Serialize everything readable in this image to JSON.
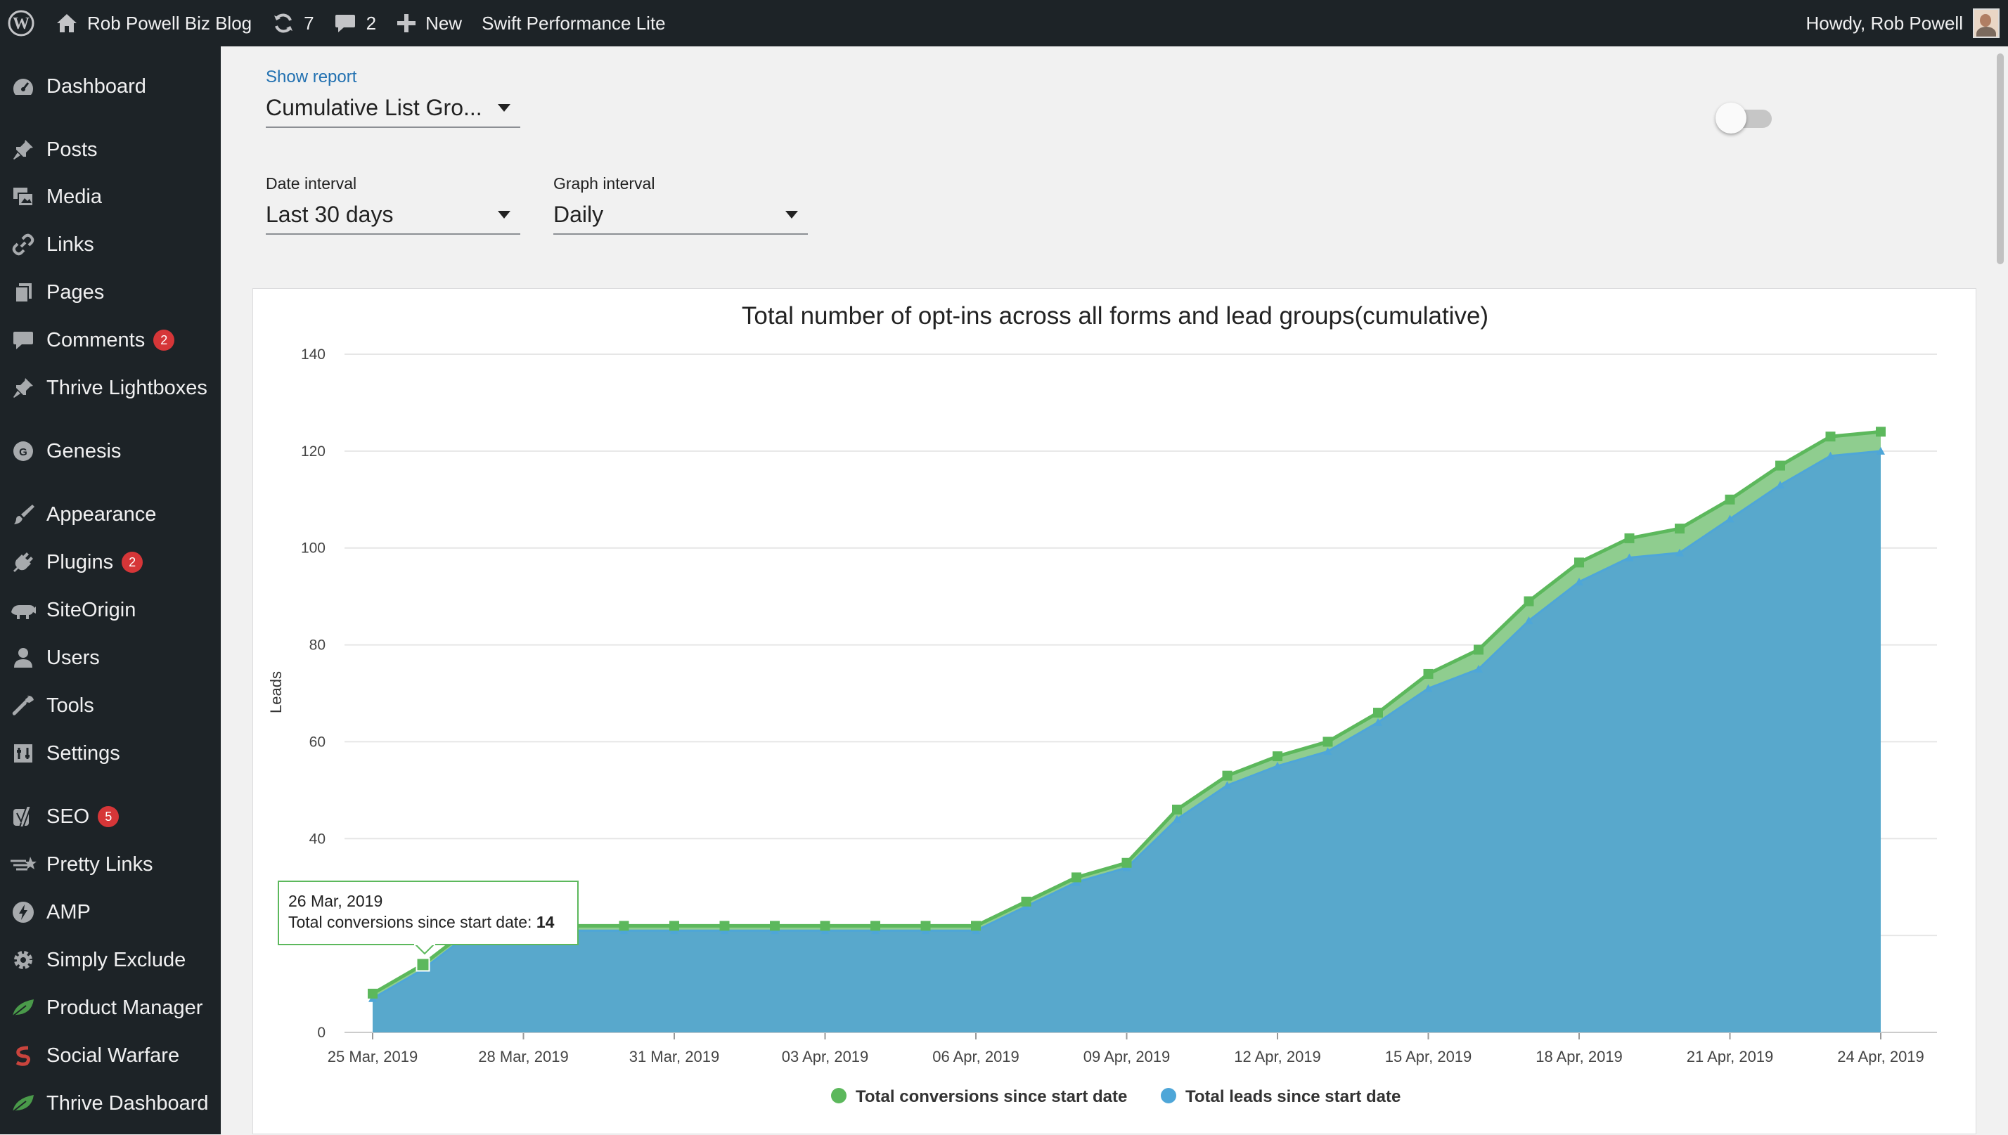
{
  "adminbar": {
    "site_name": "Rob Powell Biz Blog",
    "updates_count": "7",
    "comments_count": "2",
    "new_label": "New",
    "plugin_label": "Swift Performance Lite",
    "howdy": "Howdy, Rob Powell"
  },
  "sidebar": {
    "items": [
      {
        "label": "Dashboard",
        "icon": "dashboard-icon"
      },
      {
        "label": "Posts",
        "icon": "pushpin-icon"
      },
      {
        "label": "Media",
        "icon": "media-icon"
      },
      {
        "label": "Links",
        "icon": "link-icon"
      },
      {
        "label": "Pages",
        "icon": "pages-icon"
      },
      {
        "label": "Comments",
        "icon": "comment-icon",
        "badge": "2"
      },
      {
        "label": "Thrive Lightboxes",
        "icon": "pushpin-icon"
      },
      {
        "label": "Genesis",
        "icon": "genesis-icon"
      },
      {
        "label": "Appearance",
        "icon": "paintbrush-icon"
      },
      {
        "label": "Plugins",
        "icon": "plugin-icon",
        "badge": "2"
      },
      {
        "label": "SiteOrigin",
        "icon": "siteorigin-icon"
      },
      {
        "label": "Users",
        "icon": "user-icon"
      },
      {
        "label": "Tools",
        "icon": "wrench-icon"
      },
      {
        "label": "Settings",
        "icon": "settings-icon"
      },
      {
        "label": "SEO",
        "icon": "yoast-icon",
        "badge": "5"
      },
      {
        "label": "Pretty Links",
        "icon": "star-link-icon"
      },
      {
        "label": "AMP",
        "icon": "amp-icon"
      },
      {
        "label": "Simply Exclude",
        "icon": "gear-icon"
      },
      {
        "label": "Product Manager",
        "icon": "leaf-icon"
      },
      {
        "label": "Social Warfare",
        "icon": "social-warfare-icon"
      },
      {
        "label": "Thrive Dashboard",
        "icon": "leaf-icon"
      }
    ]
  },
  "report": {
    "show_report_label": "Show report",
    "show_report_value": "Cumulative List Gro...",
    "date_interval_label": "Date interval",
    "date_interval_value": "Last 30 days",
    "graph_interval_label": "Graph interval",
    "graph_interval_value": "Daily"
  },
  "tooltip": {
    "date": "26 Mar, 2019",
    "label": "Total conversions since start date: ",
    "value": "14"
  },
  "colors": {
    "conversions": "#5cb85c",
    "conversions_fill": "#8fcd8f",
    "leads": "#4ea6d8",
    "leads_fill": "#58a8cc",
    "badge": "#d63638"
  },
  "chart_data": {
    "type": "area",
    "title": "Total number of opt-ins across all forms and lead groups(cumulative)",
    "ylabel": "Leads",
    "xlabel": "",
    "ylim": [
      0,
      140
    ],
    "yticks": [
      0,
      20,
      40,
      60,
      80,
      100,
      120,
      140
    ],
    "x_tick_labels": [
      "25 Mar, 2019",
      "28 Mar, 2019",
      "31 Mar, 2019",
      "03 Apr, 2019",
      "06 Apr, 2019",
      "09 Apr, 2019",
      "12 Apr, 2019",
      "15 Apr, 2019",
      "18 Apr, 2019",
      "21 Apr, 2019",
      "24 Apr, 2019"
    ],
    "x": [
      "25 Mar, 2019",
      "26 Mar, 2019",
      "27 Mar, 2019",
      "28 Mar, 2019",
      "29 Mar, 2019",
      "30 Mar, 2019",
      "31 Mar, 2019",
      "01 Apr, 2019",
      "02 Apr, 2019",
      "03 Apr, 2019",
      "04 Apr, 2019",
      "05 Apr, 2019",
      "06 Apr, 2019",
      "07 Apr, 2019",
      "08 Apr, 2019",
      "09 Apr, 2019",
      "10 Apr, 2019",
      "11 Apr, 2019",
      "12 Apr, 2019",
      "13 Apr, 2019",
      "14 Apr, 2019",
      "15 Apr, 2019",
      "16 Apr, 2019",
      "17 Apr, 2019",
      "18 Apr, 2019",
      "19 Apr, 2019",
      "20 Apr, 2019",
      "21 Apr, 2019",
      "22 Apr, 2019",
      "23 Apr, 2019",
      "24 Apr, 2019"
    ],
    "series": [
      {
        "name": "Total conversions since start date",
        "values": [
          8,
          14,
          22,
          22,
          22,
          22,
          22,
          22,
          22,
          22,
          22,
          22,
          22,
          27,
          32,
          35,
          46,
          53,
          57,
          60,
          66,
          74,
          79,
          89,
          97,
          102,
          104,
          110,
          117,
          123,
          124
        ]
      },
      {
        "name": "Total leads since start date",
        "values": [
          7,
          13,
          21,
          21,
          21,
          21,
          21,
          21,
          21,
          21,
          21,
          21,
          21,
          26,
          31,
          34,
          44,
          51,
          55,
          58,
          64,
          71,
          75,
          85,
          93,
          98,
          99,
          106,
          113,
          119,
          120
        ]
      }
    ],
    "legend_position": "bottom",
    "grid": true
  }
}
